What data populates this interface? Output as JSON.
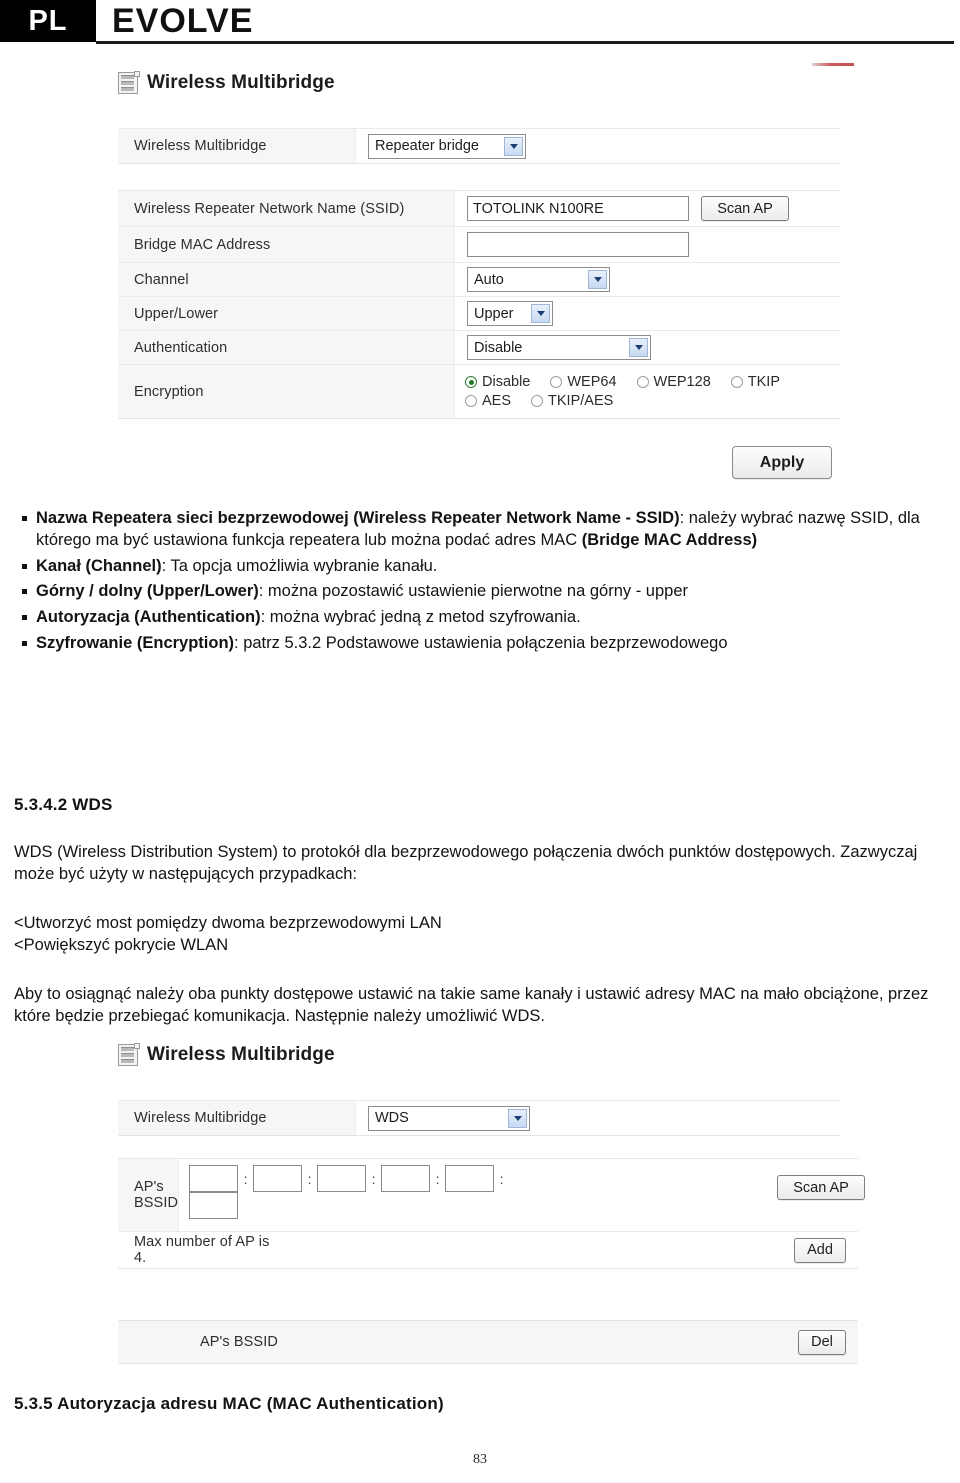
{
  "header": {
    "lang_badge": "PL",
    "brand": "EVOLVE"
  },
  "panel1": {
    "title": "Wireless Multibridge",
    "icon": "server-list-icon",
    "mode_row": {
      "label": "Wireless Multibridge",
      "value": "Repeater bridge"
    },
    "rows": [
      {
        "label": "Wireless Repeater Network Name (SSID)",
        "value": "TOTOLINK N100RE",
        "button": "Scan AP"
      },
      {
        "label": "Bridge MAC Address",
        "value": ""
      },
      {
        "label": "Channel",
        "value": "Auto"
      },
      {
        "label": "Upper/Lower",
        "value": "Upper"
      },
      {
        "label": "Authentication",
        "value": "Disable"
      },
      {
        "label": "Encryption"
      }
    ],
    "encryption": {
      "line1": [
        {
          "label": "Disable",
          "selected": true
        },
        {
          "label": "WEP64",
          "selected": false
        },
        {
          "label": "WEP128",
          "selected": false
        },
        {
          "label": "TKIP",
          "selected": false
        }
      ],
      "line2": [
        {
          "label": "AES",
          "selected": false
        },
        {
          "label": "TKIP/AES",
          "selected": false
        }
      ]
    },
    "apply_label": "Apply"
  },
  "bullets": [
    {
      "bold": "Nazwa Repeatera sieci bezprzewodowej (Wireless Repeater Network Name - SSID)",
      "rest": ": należy wybrać nazwę SSID, dla którego ma być ustawiona funkcja repeatera lub można podać adres MAC ",
      "bold2": "(Bridge MAC Address)"
    },
    {
      "bold": "Kanał (Channel)",
      "rest": ": Ta opcja umożliwia wybranie kanału."
    },
    {
      "bold": "Górny / dolny (Upper/Lower)",
      "rest": ": można pozostawić ustawienie pierwotne na górny - upper"
    },
    {
      "bold": "Autoryzacja (Authentication)",
      "rest": ": można wybrać jedną z metod szyfrowania."
    },
    {
      "bold": "Szyfrowanie (Encryption)",
      "rest": ": patrz 5.3.2 Podstawowe ustawienia połączenia bezprzewodowego"
    }
  ],
  "section_wds": {
    "heading": "5.3.4.2 WDS",
    "para1": "WDS (Wireless Distribution System) to protokół dla bezprzewodowego połączenia dwóch punktów dostępowych.  Zazwyczaj może być użyty w następujących przypadkach:",
    "list_line1": "<Utworzyć most pomiędzy dwoma bezprzewodowymi LAN",
    "list_line2": "<Powiększyć pokrycie WLAN",
    "para2": "Aby to osiągnąć należy oba punkty dostępowe ustawić na takie same kanały i ustawić adresy MAC na mało obciążone, przez które będzie przebiegać komunikacja. Następnie należy umożliwić WDS."
  },
  "panel2": {
    "title": "Wireless Multibridge",
    "icon": "server-list-icon",
    "mode_row": {
      "label": "Wireless Multibridge",
      "value": "WDS"
    },
    "bssid_row": {
      "label": "AP's BSSID",
      "separator": ":",
      "octets": [
        "",
        "",
        "",
        "",
        "",
        ""
      ],
      "scan_label": "Scan AP"
    },
    "max_note": "Max number of AP is 4.",
    "add_label": "Add",
    "list_row": {
      "label": "AP's BSSID",
      "del_label": "Del"
    }
  },
  "section_mac": {
    "heading": "5.3.5 Autoryzacja adresu MAC (MAC Authentication)"
  },
  "footer": {
    "page_number": "83"
  }
}
